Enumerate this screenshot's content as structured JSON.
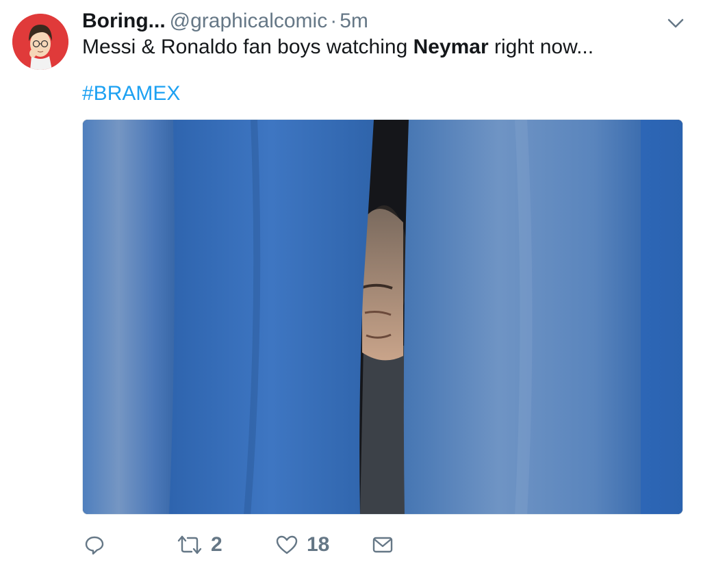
{
  "tweet": {
    "display_name": "Boring...",
    "handle": "@graphicalcomic",
    "separator": "·",
    "time": "5m",
    "text_before": "Messi & Ronaldo fan boys watching ",
    "text_bold": "Neymar",
    "text_after": " right now...",
    "hashtag": "#BRAMEX"
  },
  "actions": {
    "reply_icon": "reply-icon",
    "retweet_icon": "retweet-icon",
    "retweet_count": "2",
    "like_icon": "heart-icon",
    "like_count": "18",
    "message_icon": "envelope-icon"
  },
  "colors": {
    "link": "#1da1f2",
    "muted": "#657786",
    "avatar_bg": "#e03a3a",
    "curtain": "#3d6fb0"
  }
}
